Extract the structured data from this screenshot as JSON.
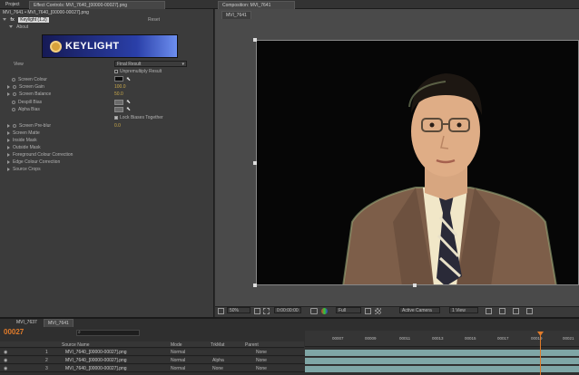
{
  "top_tabs": {
    "project": "Project",
    "effect_controls": "Effect Controls: MVI_7640_[00000-00027].png",
    "composition": "Composition: MVI_7641"
  },
  "effect_controls": {
    "breadcrumb": "MVI_7641 • MVI_7640_[00000-00027].png",
    "effect_name": "Keylight (1.2)",
    "reset_label": "Reset",
    "about_label": "About",
    "logo_text": "KEYLIGHT",
    "view_label": "View",
    "view_value": "Final Result",
    "unpremultiply_label": "Unpremultiply Result",
    "screen_colour_label": "Screen Colour",
    "screen_gain_label": "Screen Gain",
    "screen_gain_value": "100.0",
    "screen_balance_label": "Screen Balance",
    "screen_balance_value": "50.0",
    "despill_bias_label": "Despill Bias",
    "alpha_bias_label": "Alpha Bias",
    "lock_biases_label": "Lock Biases Together",
    "screen_preblur_label": "Screen Pre-blur",
    "screen_preblur_value": "0.0",
    "groups": [
      "Screen Matte",
      "Inside Mask",
      "Outside Mask",
      "Foreground Colour Correction",
      "Edge Colour Correction",
      "Source Crops"
    ]
  },
  "composition": {
    "subtab": "MVI_7641",
    "zoom": "50%",
    "timecode": "0:00:00:00",
    "resolution": "Full",
    "camera": "Active Camera",
    "views": "1 View"
  },
  "timeline": {
    "tabs": [
      "MVI_7637",
      "MVI_7641"
    ],
    "current_time": "00027",
    "search_placeholder": "",
    "headers": {
      "source": "Source Name",
      "mode": "Mode",
      "trkmat": "TrkMat",
      "parent": "Parent"
    },
    "ruler": [
      "00007",
      "00009",
      "00011",
      "00013",
      "00015",
      "00017",
      "00019",
      "00021",
      "00023",
      "00025"
    ],
    "layers": [
      {
        "num": "1",
        "name": "MVI_7640_[00000-00027].png",
        "mode": "Normal",
        "trkmat": "",
        "parent": "None"
      },
      {
        "num": "2",
        "name": "MVI_7640_[00000-00027].png",
        "mode": "Normal",
        "trkmat": "Alpha",
        "parent": "None"
      },
      {
        "num": "3",
        "name": "MVI_7640_[00000-00027].png",
        "mode": "Normal",
        "trkmat": "None",
        "parent": "None"
      }
    ]
  },
  "colors": {
    "accent": "#c9a94a",
    "timeline_bar": "#7fa6a6",
    "current_time": "#e07b2a"
  }
}
